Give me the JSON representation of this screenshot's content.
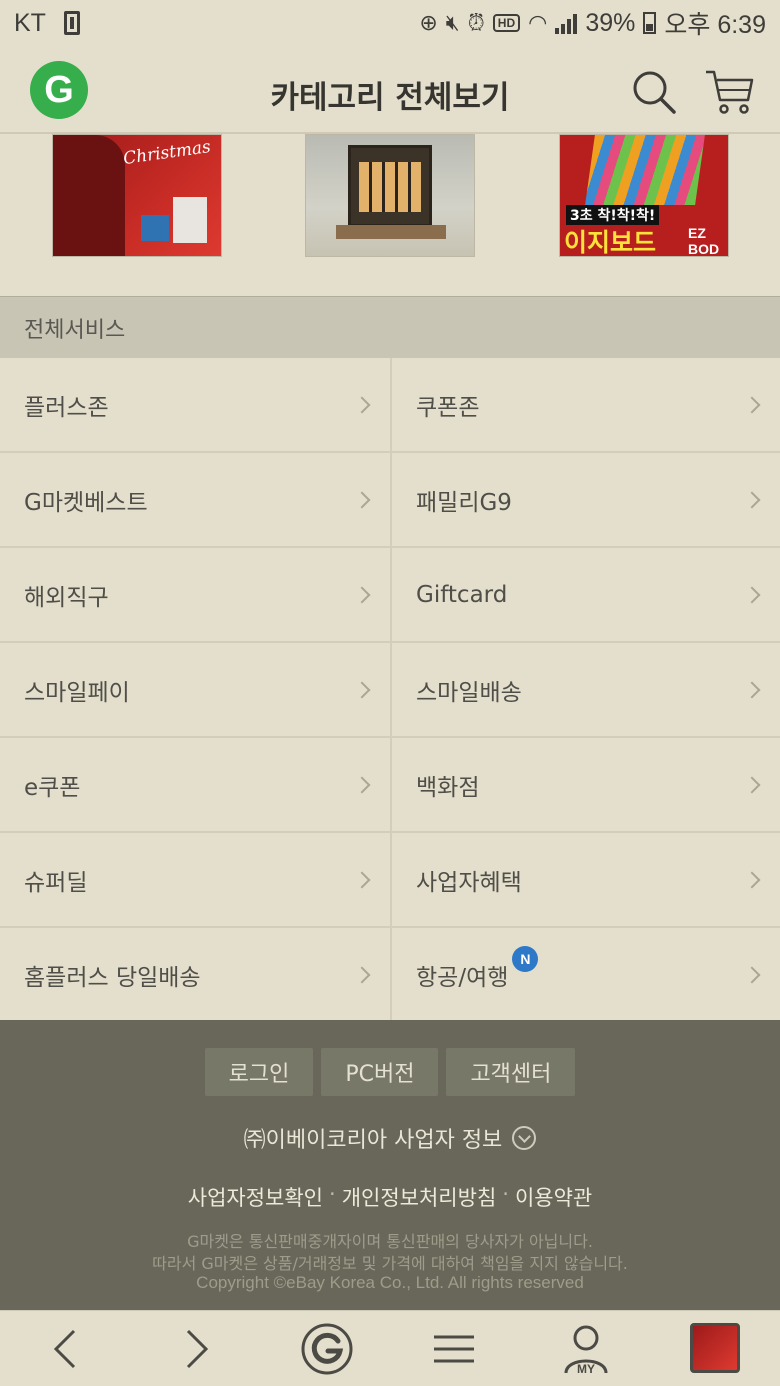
{
  "status_bar": {
    "carrier": "KT",
    "battery": "39%",
    "time": "오후 6:39"
  },
  "header": {
    "logo": "G",
    "title": "카테고리 전체보기"
  },
  "banners": {
    "items": [
      {
        "name": "christmas-banner",
        "text": "Christmas"
      },
      {
        "name": "miniature-house-banner"
      },
      {
        "name": "ez-board-banner",
        "text_top": "3초 착!착!착!",
        "text_main": "이지보드",
        "text_sub": "EZ BOD"
      }
    ]
  },
  "section": {
    "title": "전체서비스"
  },
  "services": [
    {
      "left": "플러스존",
      "right": "쿠폰존"
    },
    {
      "left": "G마켓베스트",
      "right": "패밀리G9"
    },
    {
      "left": "해외직구",
      "right": "Giftcard"
    },
    {
      "left": "스마일페이",
      "right": "스마일배송"
    },
    {
      "left": "e쿠폰",
      "right": "백화점"
    },
    {
      "left": "슈퍼딜",
      "right": "사업자혜택"
    },
    {
      "left": "홈플러스 당일배송",
      "right": "항공/여행",
      "right_badge": "N"
    }
  ],
  "footer": {
    "buttons": [
      "로그인",
      "PC버전",
      "고객센터"
    ],
    "company_info": "㈜이베이코리아 사업자 정보",
    "links": [
      "사업자정보확인",
      "개인정보처리방침",
      "이용약관"
    ],
    "disclaimer_1": "G마켓은 통신판매중개자이며 통신판매의 당사자가 아닙니다.",
    "disclaimer_2": "따라서 G마켓은 상품/거래정보 및 가격에 대하여 책임을 지지 않습니다.",
    "copyright": "Copyright ©eBay Korea Co., Ltd. All rights reserved"
  },
  "bottom_nav": {
    "my_label": "MY"
  },
  "colors": {
    "brand_green": "#35ae4b",
    "badge_blue": "#2d79c7",
    "footer_bg": "#686759"
  }
}
